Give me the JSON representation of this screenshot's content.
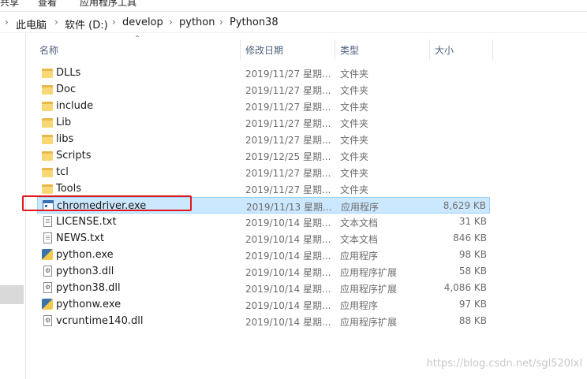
{
  "ribbon": {
    "left_text": "共享",
    "mid_text": "查看",
    "right_text": "应用程序工具"
  },
  "breadcrumb": [
    "此电脑",
    "软件 (D:)",
    "develop",
    "python",
    "Python38"
  ],
  "columns": {
    "name": "名称",
    "date": "修改日期",
    "type": "类型",
    "size": "大小"
  },
  "rows": [
    {
      "name": "DLLs",
      "date": "2019/11/27 星期...",
      "type": "文件夹",
      "size": "",
      "icon": "folder-icon"
    },
    {
      "name": "Doc",
      "date": "2019/11/27 星期...",
      "type": "文件夹",
      "size": "",
      "icon": "folder-icon"
    },
    {
      "name": "include",
      "date": "2019/11/27 星期...",
      "type": "文件夹",
      "size": "",
      "icon": "folder-icon"
    },
    {
      "name": "Lib",
      "date": "2019/11/27 星期...",
      "type": "文件夹",
      "size": "",
      "icon": "folder-icon"
    },
    {
      "name": "libs",
      "date": "2019/11/27 星期...",
      "type": "文件夹",
      "size": "",
      "icon": "folder-icon"
    },
    {
      "name": "Scripts",
      "date": "2019/12/25 星期...",
      "type": "文件夹",
      "size": "",
      "icon": "folder-icon"
    },
    {
      "name": "tcl",
      "date": "2019/11/27 星期...",
      "type": "文件夹",
      "size": "",
      "icon": "folder-icon"
    },
    {
      "name": "Tools",
      "date": "2019/11/27 星期...",
      "type": "文件夹",
      "size": "",
      "icon": "folder-icon"
    },
    {
      "name": "chromedriver.exe",
      "date": "2019/11/13 星期...",
      "type": "应用程序",
      "size": "8,629 KB",
      "icon": "exe-icon"
    },
    {
      "name": "LICENSE.txt",
      "date": "2019/10/14 星期...",
      "type": "文本文档",
      "size": "31 KB",
      "icon": "text-file-icon"
    },
    {
      "name": "NEWS.txt",
      "date": "2019/10/14 星期...",
      "type": "文本文档",
      "size": "846 KB",
      "icon": "text-file-icon"
    },
    {
      "name": "python.exe",
      "date": "2019/10/14 星期...",
      "type": "应用程序",
      "size": "98 KB",
      "icon": "python-icon"
    },
    {
      "name": "python3.dll",
      "date": "2019/10/14 星期...",
      "type": "应用程序扩展",
      "size": "58 KB",
      "icon": "dll-icon"
    },
    {
      "name": "python38.dll",
      "date": "2019/10/14 星期...",
      "type": "应用程序扩展",
      "size": "4,086 KB",
      "icon": "dll-icon"
    },
    {
      "name": "pythonw.exe",
      "date": "2019/10/14 星期...",
      "type": "应用程序",
      "size": "97 KB",
      "icon": "python-icon"
    },
    {
      "name": "vcruntime140.dll",
      "date": "2019/10/14 星期...",
      "type": "应用程序扩展",
      "size": "88 KB",
      "icon": "dll-icon"
    }
  ],
  "watermark": "https://blog.csdn.net/sgl520lxl",
  "colors": {
    "selected_bg": "#cce8ff",
    "highlight_border": "#e0191d",
    "folder": "#f8d775"
  }
}
